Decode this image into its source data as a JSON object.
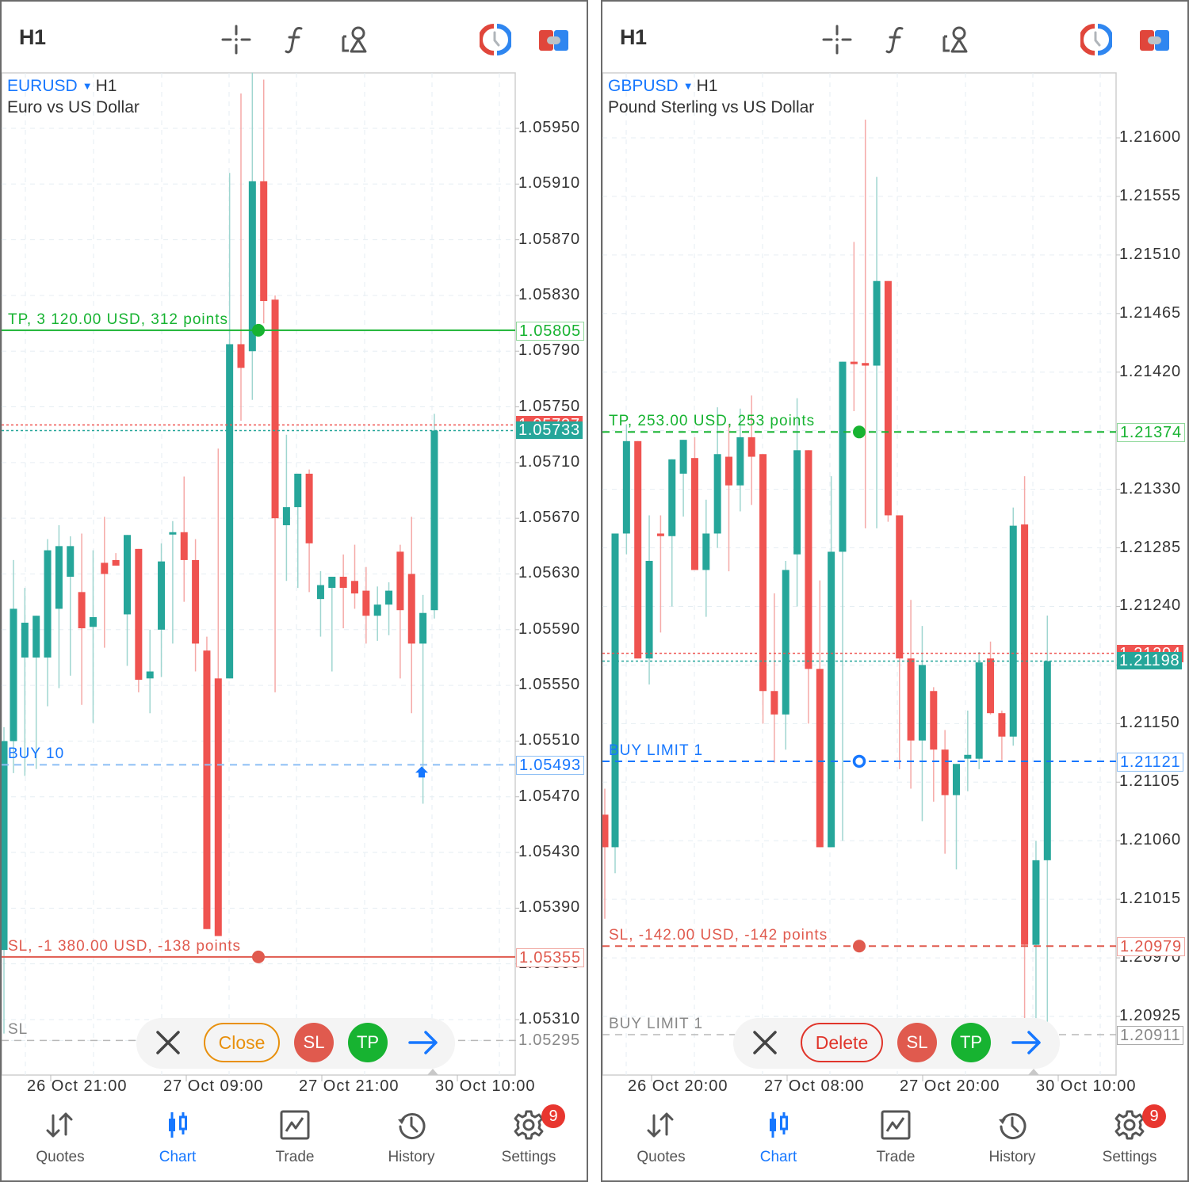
{
  "colors": {
    "bull": "#26a69a",
    "bear": "#ef5350",
    "tp": "#17b331",
    "sl": "#e05a4e",
    "buy": "#1677ff",
    "grey_line": "#9a9a9a",
    "grid": "#e6eef3",
    "accent": "#1677ff"
  },
  "panels": [
    {
      "toolbar": {
        "timeframe": "H1",
        "icons": [
          "crosshair-icon",
          "indicators-f-icon",
          "objects-icon",
          "one-click-trading-icon",
          "trade-toggle-icon"
        ]
      },
      "symbol": "EURUSD",
      "timeframe": "H1",
      "description": "Euro vs US Dollar",
      "price_axis": [
        "1.05950",
        "1.05910",
        "1.05870",
        "1.05830",
        "1.05790",
        "1.05750",
        "1.05710",
        "1.05670",
        "1.05630",
        "1.05590",
        "1.05550",
        "1.05510",
        "1.05470",
        "1.05430",
        "1.05390",
        "1.05350",
        "1.05310",
        "1.05295"
      ],
      "time_axis": [
        "26 Oct 21:00",
        "27 Oct 09:00",
        "27 Oct 21:00",
        "30 Oct 10:00"
      ],
      "lines": {
        "tp": {
          "label": "TP, 3 120.00 USD, 312 points",
          "price": "1.05805",
          "style": "solid"
        },
        "sl": {
          "label": "SL, -1 380.00 USD, -138 points",
          "price": "1.05355",
          "style": "solid"
        },
        "entry": {
          "label": "BUY 10",
          "price": "1.05493"
        },
        "pending_sl": {
          "label": "SL",
          "price": "1.05295"
        },
        "ask": {
          "price": "1.05737"
        },
        "bid": {
          "price": "1.05733"
        }
      },
      "actions": {
        "close_label": "",
        "primary_label": "Close",
        "primary_color": "#e8900c",
        "sl_label": "SL",
        "tp_label": "TP"
      }
    },
    {
      "toolbar": {
        "timeframe": "H1",
        "icons": [
          "crosshair-icon",
          "indicators-f-icon",
          "objects-icon",
          "one-click-trading-icon",
          "trade-toggle-icon"
        ]
      },
      "symbol": "GBPUSD",
      "timeframe": "H1",
      "description": "Pound Sterling vs US Dollar",
      "price_axis": [
        "1.21600",
        "1.21555",
        "1.21510",
        "1.21465",
        "1.21420",
        "1.21375",
        "1.21330",
        "1.21285",
        "1.21240",
        "1.21195",
        "1.21150",
        "1.21105",
        "1.21060",
        "1.21015",
        "1.20970",
        "1.20925"
      ],
      "time_axis": [
        "26 Oct 20:00",
        "27 Oct 08:00",
        "27 Oct 20:00",
        "30 Oct 10:00"
      ],
      "lines": {
        "tp": {
          "label": "TP, 253.00 USD, 253 points",
          "price": "1.21374",
          "style": "dashed"
        },
        "sl": {
          "label": "SL, -142.00 USD, -142 points",
          "price": "1.20979",
          "style": "dashed"
        },
        "entry": {
          "label": "BUY LIMIT 1",
          "price": "1.21121"
        },
        "pending_sl": {
          "label": "BUY LIMIT 1",
          "price": "1.20911"
        },
        "ask": {
          "price": "1.21204"
        },
        "bid": {
          "price": "1.21198"
        }
      },
      "actions": {
        "close_label": "",
        "primary_label": "Delete",
        "primary_color": "#e0352b",
        "sl_label": "SL",
        "tp_label": "TP"
      }
    }
  ],
  "tabbar": {
    "items": [
      {
        "label": "Quotes",
        "icon": "quotes-arrows-icon",
        "active": false
      },
      {
        "label": "Chart",
        "icon": "candlestick-chart-icon",
        "active": true
      },
      {
        "label": "Trade",
        "icon": "trade-chart-icon",
        "active": false
      },
      {
        "label": "History",
        "icon": "history-clock-icon",
        "active": false
      },
      {
        "label": "Settings",
        "icon": "gear-icon",
        "active": false,
        "badge": "9"
      }
    ]
  },
  "chart_data": [
    {
      "type": "candlestick",
      "title": "EURUSD H1 — Euro vs US Dollar",
      "ylim": [
        1.0527,
        1.06
      ],
      "x_ticks": [
        "26 Oct 21:00",
        "27 Oct 09:00",
        "27 Oct 21:00",
        "30 Oct 10:00"
      ],
      "candles": [
        {
          "o": 1.0536,
          "h": 1.0552,
          "l": 1.053,
          "c": 1.0551
        },
        {
          "o": 1.0551,
          "h": 1.0564,
          "l": 1.05487,
          "c": 1.05605
        },
        {
          "o": 1.0557,
          "h": 1.0562,
          "l": 1.05485,
          "c": 1.05595
        },
        {
          "o": 1.0557,
          "h": 1.056,
          "l": 1.0549,
          "c": 1.056
        },
        {
          "o": 1.0557,
          "h": 1.05655,
          "l": 1.05535,
          "c": 1.05647
        },
        {
          "o": 1.05605,
          "h": 1.05665,
          "l": 1.05548,
          "c": 1.0565
        },
        {
          "o": 1.05628,
          "h": 1.05657,
          "l": 1.05557,
          "c": 1.0565
        },
        {
          "o": 1.05617,
          "h": 1.05659,
          "l": 1.05536,
          "c": 1.05591
        },
        {
          "o": 1.05592,
          "h": 1.05647,
          "l": 1.05523,
          "c": 1.05599
        },
        {
          "o": 1.05638,
          "h": 1.05671,
          "l": 1.05577,
          "c": 1.0563
        },
        {
          "o": 1.0564,
          "h": 1.05645,
          "l": 1.05637,
          "c": 1.05636
        },
        {
          "o": 1.05601,
          "h": 1.05647,
          "l": 1.05564,
          "c": 1.05658
        },
        {
          "o": 1.05648,
          "h": 1.05645,
          "l": 1.05545,
          "c": 1.05554
        },
        {
          "o": 1.05555,
          "h": 1.0559,
          "l": 1.0553,
          "c": 1.0556
        },
        {
          "o": 1.0559,
          "h": 1.05652,
          "l": 1.05556,
          "c": 1.05639
        },
        {
          "o": 1.0566,
          "h": 1.05668,
          "l": 1.0558,
          "c": 1.0566
        },
        {
          "o": 1.0566,
          "h": 1.057,
          "l": 1.0561,
          "c": 1.0564
        },
        {
          "o": 1.0564,
          "h": 1.05655,
          "l": 1.0556,
          "c": 1.0558
        },
        {
          "o": 1.05575,
          "h": 1.05585,
          "l": 1.0538,
          "c": 1.05375
        },
        {
          "o": 1.05555,
          "h": 1.0572,
          "l": 1.05378,
          "c": 1.0537
        },
        {
          "o": 1.05555,
          "h": 1.05918,
          "l": 1.05555,
          "c": 1.05795
        },
        {
          "o": 1.05795,
          "h": 1.05975,
          "l": 1.0574,
          "c": 1.05778
        },
        {
          "o": 1.0579,
          "h": 1.0599,
          "l": 1.05755,
          "c": 1.05912
        },
        {
          "o": 1.05912,
          "h": 1.05985,
          "l": 1.0581,
          "c": 1.05826
        },
        {
          "o": 1.05827,
          "h": 1.0583,
          "l": 1.05545,
          "c": 1.0567
        },
        {
          "o": 1.05665,
          "h": 1.0573,
          "l": 1.05625,
          "c": 1.05678
        },
        {
          "o": 1.05678,
          "h": 1.057,
          "l": 1.0562,
          "c": 1.05702
        },
        {
          "o": 1.05702,
          "h": 1.05705,
          "l": 1.05617,
          "c": 1.05652
        },
        {
          "o": 1.05612,
          "h": 1.05632,
          "l": 1.05585,
          "c": 1.05622
        },
        {
          "o": 1.0562,
          "h": 1.05625,
          "l": 1.0556,
          "c": 1.05628
        },
        {
          "o": 1.05628,
          "h": 1.05644,
          "l": 1.05591,
          "c": 1.0562
        },
        {
          "o": 1.05625,
          "h": 1.05651,
          "l": 1.05605,
          "c": 1.05616
        },
        {
          "o": 1.05618,
          "h": 1.05635,
          "l": 1.0558,
          "c": 1.056
        },
        {
          "o": 1.056,
          "h": 1.05621,
          "l": 1.05582,
          "c": 1.05608
        },
        {
          "o": 1.05608,
          "h": 1.05624,
          "l": 1.05586,
          "c": 1.05618
        },
        {
          "o": 1.05646,
          "h": 1.05651,
          "l": 1.05555,
          "c": 1.05604
        },
        {
          "o": 1.0563,
          "h": 1.05671,
          "l": 1.0553,
          "c": 1.0558
        },
        {
          "o": 1.0558,
          "h": 1.05615,
          "l": 1.05465,
          "c": 1.05602
        },
        {
          "o": 1.05604,
          "h": 1.05745,
          "l": 1.05598,
          "c": 1.05733
        }
      ],
      "levels": {
        "tp": 1.05805,
        "sl": 1.05355,
        "entry": 1.05493,
        "pending_sl": 1.05295,
        "ask": 1.05737,
        "bid": 1.05733
      }
    },
    {
      "type": "candlestick",
      "title": "GBPUSD H1 — Pound Sterling vs US Dollar",
      "ylim": [
        1.2088,
        1.2165
      ],
      "x_ticks": [
        "26 Oct 20:00",
        "27 Oct 08:00",
        "27 Oct 20:00",
        "30 Oct 10:00"
      ],
      "candles": [
        {
          "o": 1.2108,
          "h": 1.211,
          "l": 1.21,
          "c": 1.21055
        },
        {
          "o": 1.21055,
          "h": 1.2124,
          "l": 1.21035,
          "c": 1.21296
        },
        {
          "o": 1.21296,
          "h": 1.2138,
          "l": 1.2128,
          "c": 1.21367
        },
        {
          "o": 1.21367,
          "h": 1.2136,
          "l": 1.21201,
          "c": 1.212
        },
        {
          "o": 1.212,
          "h": 1.2131,
          "l": 1.2118,
          "c": 1.21275
        },
        {
          "o": 1.21296,
          "h": 1.2131,
          "l": 1.2122,
          "c": 1.21294
        },
        {
          "o": 1.21294,
          "h": 1.21335,
          "l": 1.2124,
          "c": 1.21353
        },
        {
          "o": 1.21342,
          "h": 1.21358,
          "l": 1.21309,
          "c": 1.21368
        },
        {
          "o": 1.21354,
          "h": 1.2137,
          "l": 1.2127,
          "c": 1.21268
        },
        {
          "o": 1.21268,
          "h": 1.21322,
          "l": 1.21232,
          "c": 1.21296
        },
        {
          "o": 1.21296,
          "h": 1.21393,
          "l": 1.21285,
          "c": 1.21357
        },
        {
          "o": 1.21355,
          "h": 1.2138,
          "l": 1.21267,
          "c": 1.21333
        },
        {
          "o": 1.21333,
          "h": 1.21392,
          "l": 1.21313,
          "c": 1.2137
        },
        {
          "o": 1.2137,
          "h": 1.21402,
          "l": 1.21318,
          "c": 1.21355
        },
        {
          "o": 1.21357,
          "h": 1.21357,
          "l": 1.2115,
          "c": 1.21175
        },
        {
          "o": 1.21175,
          "h": 1.2125,
          "l": 1.2112,
          "c": 1.21157
        },
        {
          "o": 1.21157,
          "h": 1.21275,
          "l": 1.2113,
          "c": 1.21268
        },
        {
          "o": 1.2128,
          "h": 1.214,
          "l": 1.2124,
          "c": 1.2136
        },
        {
          "o": 1.2136,
          "h": 1.2136,
          "l": 1.2115,
          "c": 1.21192
        },
        {
          "o": 1.21192,
          "h": 1.2126,
          "l": 1.2108,
          "c": 1.21055
        },
        {
          "o": 1.21055,
          "h": 1.2134,
          "l": 1.2106,
          "c": 1.21282
        },
        {
          "o": 1.21282,
          "h": 1.21418,
          "l": 1.2106,
          "c": 1.21428
        },
        {
          "o": 1.21428,
          "h": 1.2152,
          "l": 1.2139,
          "c": 1.21427
        },
        {
          "o": 1.21427,
          "h": 1.21614,
          "l": 1.213,
          "c": 1.21425
        },
        {
          "o": 1.21425,
          "h": 1.2157,
          "l": 1.213,
          "c": 1.2149
        },
        {
          "o": 1.2149,
          "h": 1.2149,
          "l": 1.21305,
          "c": 1.2131
        },
        {
          "o": 1.2131,
          "h": 1.21276,
          "l": 1.21115,
          "c": 1.212
        },
        {
          "o": 1.212,
          "h": 1.21245,
          "l": 1.211,
          "c": 1.21137
        },
        {
          "o": 1.21137,
          "h": 1.21225,
          "l": 1.21075,
          "c": 1.21195
        },
        {
          "o": 1.21175,
          "h": 1.21178,
          "l": 1.2109,
          "c": 1.2113
        },
        {
          "o": 1.2113,
          "h": 1.21145,
          "l": 1.2105,
          "c": 1.21095
        },
        {
          "o": 1.21095,
          "h": 1.21105,
          "l": 1.21038,
          "c": 1.21119
        },
        {
          "o": 1.21123,
          "h": 1.2116,
          "l": 1.21098,
          "c": 1.21126
        },
        {
          "o": 1.21123,
          "h": 1.21205,
          "l": 1.21115,
          "c": 1.21197
        },
        {
          "o": 1.212,
          "h": 1.21213,
          "l": 1.21157,
          "c": 1.21158
        },
        {
          "o": 1.21158,
          "h": 1.2116,
          "l": 1.21122,
          "c": 1.2114
        },
        {
          "o": 1.2114,
          "h": 1.21316,
          "l": 1.21133,
          "c": 1.21302
        },
        {
          "o": 1.21303,
          "h": 1.2134,
          "l": 1.209,
          "c": 1.2098
        },
        {
          "o": 1.2098,
          "h": 1.2106,
          "l": 1.209,
          "c": 1.21045
        },
        {
          "o": 1.21045,
          "h": 1.21233,
          "l": 1.209,
          "c": 1.21198
        }
      ],
      "levels": {
        "tp": 1.21374,
        "sl": 1.20979,
        "entry": 1.21121,
        "pending_sl": 1.20911,
        "ask": 1.21204,
        "bid": 1.21198
      }
    }
  ]
}
